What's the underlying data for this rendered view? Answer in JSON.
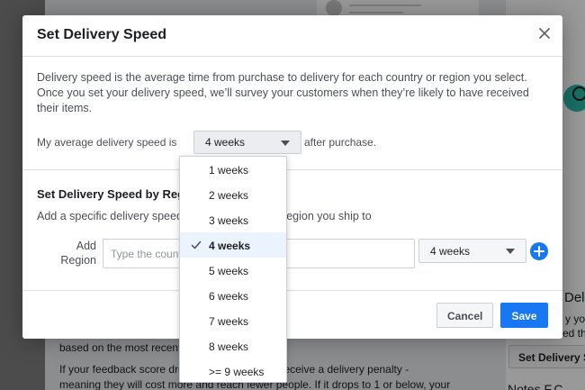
{
  "background": {
    "text_lines": [
      "based on the most recent",
      "If your feedback score drops below 2, ads will receive a delivery penalty -",
      "meaning they will cost more and reach fewer people. If it drops to 1 or below, your"
    ],
    "side_fragments": [
      "Deli",
      "y you",
      "ed the",
      "Set Delivery S",
      "Notes F.C"
    ],
    "side_button": "Set Delivery S"
  },
  "modal": {
    "title": "Set Delivery Speed",
    "description": "Delivery speed is the average time from purchase to delivery for each country or region you select. Once you set your delivery speed, we’ll survey your customers when they’re likely to have received their items.",
    "speed_label": "My average delivery speed is",
    "speed_value": "4 weeks",
    "speed_after": "after purchase.",
    "region_section": {
      "title": "Set Delivery Speed by Region",
      "description": "Add a specific delivery speed for each country or region you ship to",
      "add_label_line1": "Add",
      "add_label_line2": "Region",
      "input_placeholder": "Type the country or region",
      "region_speed_value": "4 weeks"
    },
    "buttons": {
      "cancel": "Cancel",
      "save": "Save"
    }
  },
  "dropdown": {
    "options": [
      "1 weeks",
      "2 weeks",
      "3 weeks",
      "4 weeks",
      "5 weeks",
      "6 weeks",
      "7 weeks",
      "8 weeks",
      ">= 9 weeks"
    ],
    "selected": "4 weeks"
  },
  "colors": {
    "accent": "#1877f2",
    "selected_bg": "#ebf3ff"
  }
}
